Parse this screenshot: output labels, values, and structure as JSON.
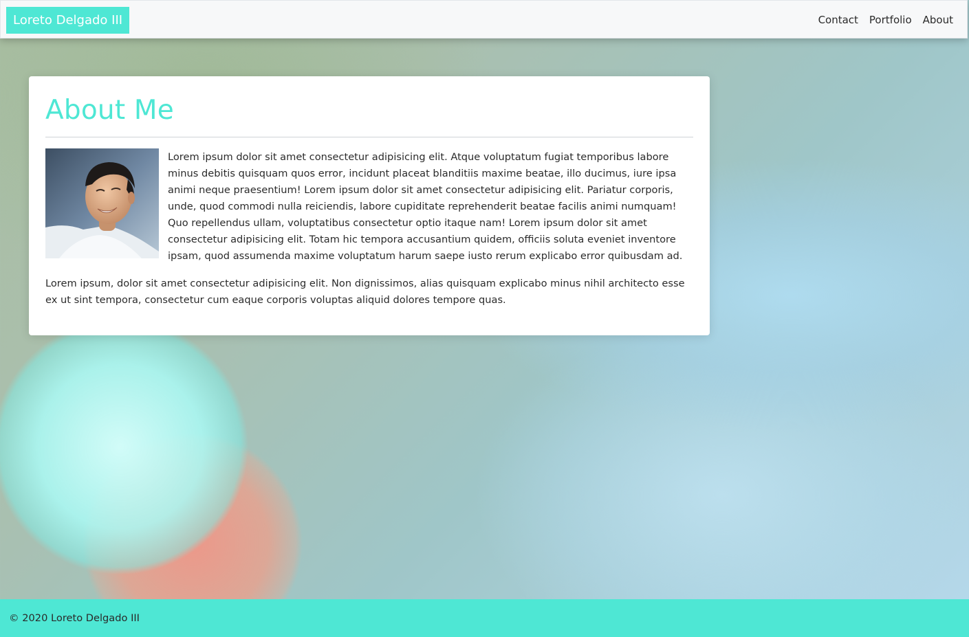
{
  "navbar": {
    "brand": "Loreto Delgado III",
    "links": [
      {
        "label": "Contact"
      },
      {
        "label": "Portfolio"
      },
      {
        "label": "About"
      }
    ]
  },
  "about": {
    "title": "About Me",
    "paragraph1": "Lorem ipsum dolor sit amet consectetur adipisicing elit. Atque voluptatum fugiat temporibus labore minus debitis quisquam quos error, incidunt placeat blanditiis maxime beatae, illo ducimus, iure ipsa animi neque praesentium! Lorem ipsum dolor sit amet consectetur adipisicing elit. Pariatur corporis, unde, quod commodi nulla reiciendis, labore cupiditate reprehenderit beatae facilis animi numquam! Quo repellendus ullam, voluptatibus consectetur optio itaque nam! Lorem ipsum dolor sit amet consectetur adipisicing elit. Totam hic tempora accusantium quidem, officiis soluta eveniet inventore ipsam, quod assumenda maxime voluptatum harum saepe iusto rerum explicabo error quibusdam ad.",
    "paragraph2": "Lorem ipsum, dolor sit amet consectetur adipisicing elit. Non dignissimos, alias quisquam explicabo minus nihil architecto esse ex ut sint tempora, consectetur cum eaque corporis voluptas aliquid dolores tempore quas."
  },
  "footer": {
    "text": "© 2020 Loreto Delgado III"
  },
  "colors": {
    "accent": "#4ee7d4",
    "navbar_bg": "#f7f8f9",
    "text": "#2b2b2b"
  }
}
